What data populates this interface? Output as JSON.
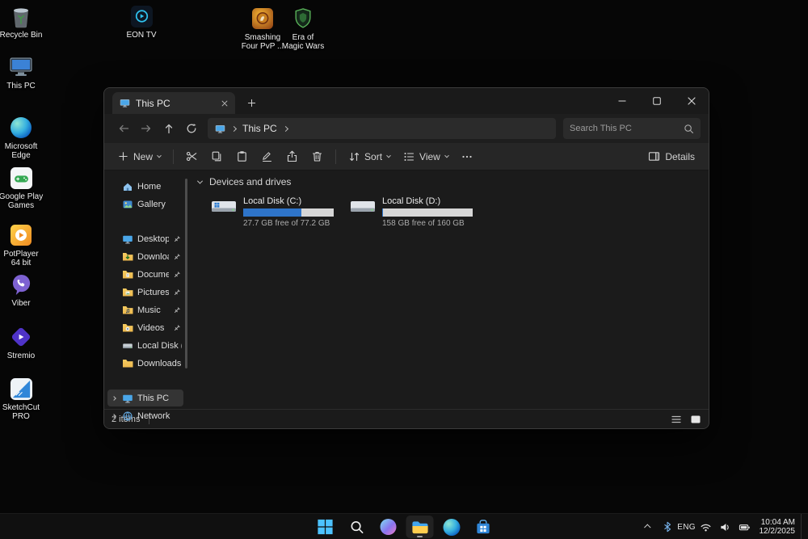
{
  "desktop": {
    "icons": [
      {
        "name": "recycle-bin",
        "label": "Recycle Bin"
      },
      {
        "name": "this-pc",
        "label": "This PC"
      },
      {
        "name": "microsoft-edge",
        "label": "Microsoft Edge"
      },
      {
        "name": "google-play-games",
        "label": "Google Play Games"
      },
      {
        "name": "potplayer",
        "label": "PotPlayer 64 bit"
      },
      {
        "name": "viber",
        "label": "Viber"
      },
      {
        "name": "stremio",
        "label": "Stremio"
      },
      {
        "name": "sketchcut-pro",
        "label": "SketchCut PRO"
      },
      {
        "name": "eon-tv",
        "label": "EON TV"
      },
      {
        "name": "smashing-four",
        "label": "Smashing Four PvP ..."
      },
      {
        "name": "era-of-magic-wars",
        "label": "Era of Magic Wars"
      }
    ]
  },
  "explorer": {
    "tab_title": "This PC",
    "address_root": "This PC",
    "search_placeholder": "Search This PC",
    "commands": {
      "new": "New",
      "sort": "Sort",
      "view": "View",
      "details": "Details"
    },
    "sidebar": [
      {
        "label": "Home"
      },
      {
        "label": "Gallery"
      },
      {
        "label": "Desktop",
        "pinned": true
      },
      {
        "label": "Downloads",
        "pinned": true
      },
      {
        "label": "Documents",
        "pinned": true
      },
      {
        "label": "Pictures",
        "pinned": true
      },
      {
        "label": "Music",
        "pinned": true
      },
      {
        "label": "Videos",
        "pinned": true
      },
      {
        "label": "Local Disk (D:)"
      },
      {
        "label": "Downloads"
      },
      {
        "label": "This PC",
        "selected": true
      },
      {
        "label": "Network"
      }
    ],
    "group_header": "Devices and drives",
    "drives": [
      {
        "name": "Local Disk (C:)",
        "free_text": "27.7 GB free of 77.2 GB",
        "used_percent": 64
      },
      {
        "name": "Local Disk (D:)",
        "free_text": "158 GB free of 160 GB",
        "used_percent": 1
      }
    ],
    "status_items": "2 items"
  },
  "taskbar": {
    "language": "ENG",
    "time": "10:04 AM",
    "date": "12/2/2025"
  },
  "colors": {
    "drive_bar_fill": "#2e74c9",
    "drive_bar_track": "#d6d6d6",
    "selection_bg": "#343434",
    "accent_blue": "#4cc2ff"
  }
}
